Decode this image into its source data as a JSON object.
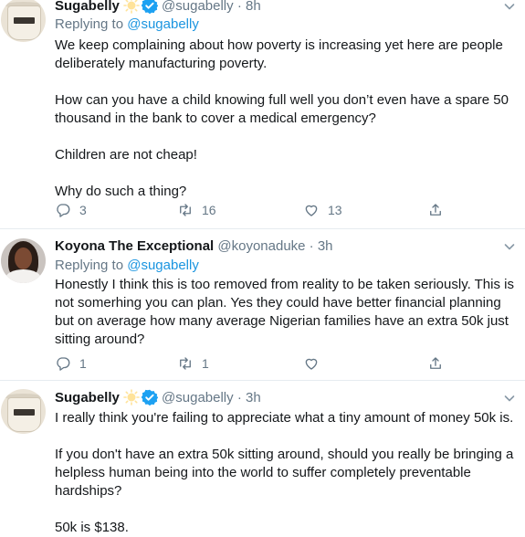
{
  "tweets": [
    {
      "name": "Sugabelly",
      "handle": "@sugabelly",
      "dot": "·",
      "time": "8h",
      "replying_prefix": "Replying to ",
      "replying_to": "@sugabelly",
      "paragraphs": [
        "We keep complaining about how poverty is increasing yet here are people deliberately manufacturing poverty.",
        "How can you have a child knowing full well you don’t even have a spare 50 thousand in the bank to cover a medical emergency?",
        "Children are not cheap!",
        "Why do such a thing?"
      ],
      "replies": "3",
      "retweets": "16",
      "likes": "13"
    },
    {
      "name": "Koyona The Exceptional",
      "handle": "@koyonaduke",
      "dot": "·",
      "time": "3h",
      "replying_prefix": "Replying to ",
      "replying_to": "@sugabelly",
      "paragraphs": [
        "Honestly I think this is too removed from  reality to be taken seriously. This is not somerhing you can plan. Yes they could have better financial planning but on average how many average Nigerian families have an extra 50k just sitting around?"
      ],
      "replies": "1",
      "retweets": "1",
      "likes": ""
    },
    {
      "name": "Sugabelly",
      "handle": "@sugabelly",
      "dot": "·",
      "time": "3h",
      "paragraphs": [
        "I really think you're failing to appreciate what a tiny amount of money 50k is.",
        "If you don't have an extra 50k sitting around, should you really be bringing a helpless human being into the world to suffer completely preventable hardships?",
        "50k is $138."
      ]
    }
  ],
  "colors": {
    "text": "#14171a",
    "muted": "#657786",
    "link": "#1b95e0",
    "verified": "#1da1f2",
    "divider": "#e6ecf0"
  }
}
